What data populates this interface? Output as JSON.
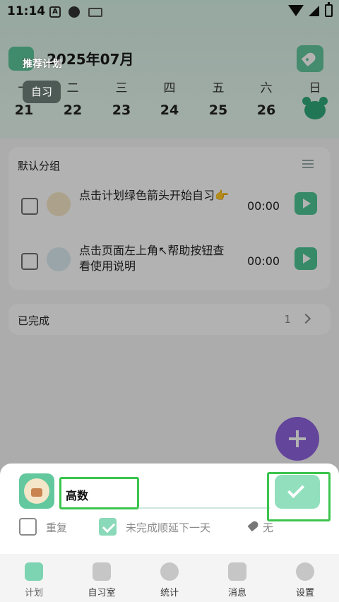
{
  "status_bar": {
    "time": "11:14",
    "a_label": "A"
  },
  "header": {
    "month": "2025年07月"
  },
  "overlay_tips": {
    "plan_tip": "推荐计划",
    "study_tip": "自习"
  },
  "week": [
    {
      "day": "一",
      "date": "21"
    },
    {
      "day": "二",
      "date": "22"
    },
    {
      "day": "三",
      "date": "23"
    },
    {
      "day": "四",
      "date": "24"
    },
    {
      "day": "五",
      "date": "25"
    },
    {
      "day": "六",
      "date": "26"
    },
    {
      "day": "日",
      "date": ""
    }
  ],
  "group": {
    "title": "默认分组",
    "tasks": [
      {
        "text": "点击计划绿色箭头开始自习👉",
        "time": "00:00"
      },
      {
        "text": "点击页面左上角↖帮助按钮查看使用说明",
        "time": "00:00"
      }
    ]
  },
  "completed": {
    "label": "已完成",
    "count": "1"
  },
  "sheet": {
    "name_value": "高数",
    "repeat_label": "重复",
    "postpone_label": "未完成顺延下一天",
    "postpone_checked": true,
    "tag_label": "无"
  },
  "nav": {
    "items": [
      {
        "label": "计划",
        "icon": "clock-icon",
        "active": true
      },
      {
        "label": "自习室",
        "icon": "bookmark-icon",
        "active": false
      },
      {
        "label": "统计",
        "icon": "pie-chart-icon",
        "active": false
      },
      {
        "label": "消息",
        "icon": "chat-bubbles-icon",
        "active": false
      },
      {
        "label": "设置",
        "icon": "bear-icon",
        "active": false
      }
    ]
  },
  "colors": {
    "accent": "#63c89e",
    "fab": "#8f63e0",
    "highlight": "#3cc44d"
  }
}
